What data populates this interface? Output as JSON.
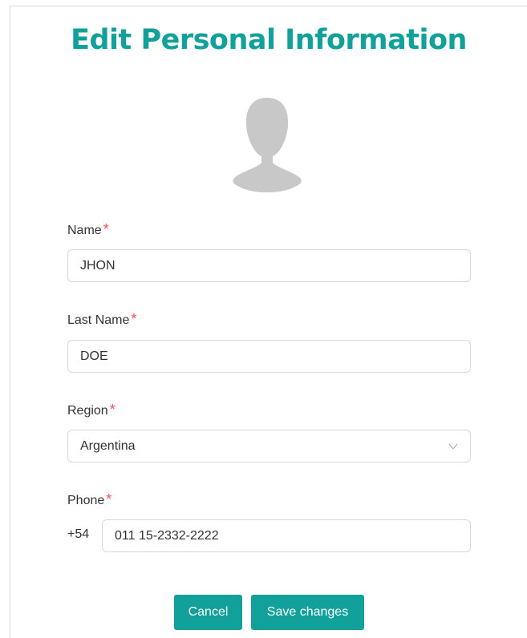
{
  "page": {
    "title": "Edit Personal Information"
  },
  "avatar": {
    "icon": "user-silhouette-icon"
  },
  "form": {
    "name": {
      "label": "Name",
      "required_mark": "*",
      "value": "JHON"
    },
    "last_name": {
      "label": "Last Name",
      "required_mark": "*",
      "value": "DOE"
    },
    "region": {
      "label": "Region",
      "required_mark": "*",
      "value": "Argentina",
      "icon": "chevron-down-icon"
    },
    "phone": {
      "label": "Phone",
      "required_mark": "*",
      "prefix": "+54",
      "value": "011 15-2332-2222"
    }
  },
  "actions": {
    "cancel_label": "Cancel",
    "save_label": "Save changes"
  },
  "colors": {
    "accent": "#12a09a",
    "required": "#ff4d4f",
    "border": "#d9d9d9",
    "avatar": "#c8c8c8"
  }
}
